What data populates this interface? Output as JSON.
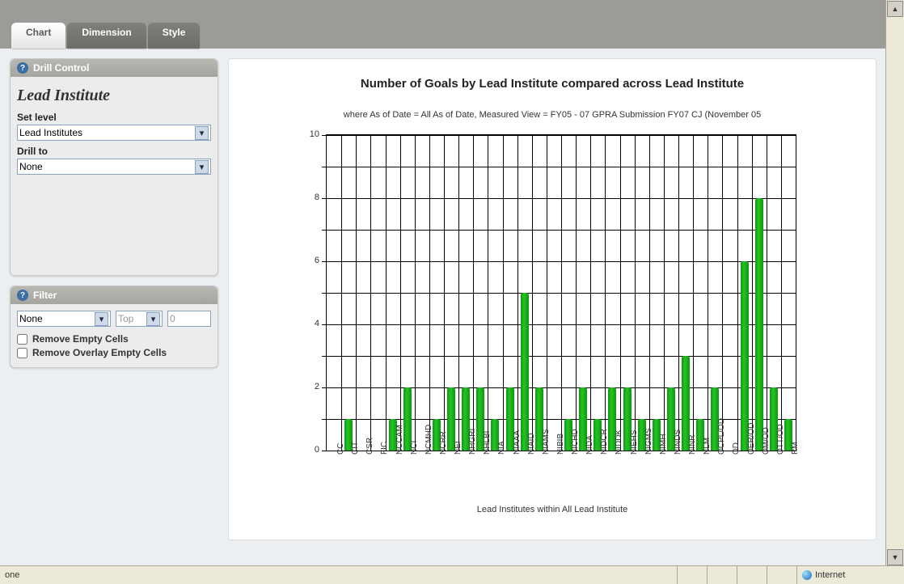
{
  "tabs": {
    "chart": "Chart",
    "dimension": "Dimension",
    "style": "Style"
  },
  "drill": {
    "panel_title": "Drill Control",
    "heading": "Lead Institute",
    "set_level_label": "Set level",
    "set_level_value": "Lead Institutes",
    "drill_to_label": "Drill to",
    "drill_to_value": "None"
  },
  "filter": {
    "panel_title": "Filter",
    "scope_value": "None",
    "dir_value": "Top",
    "count_value": "0",
    "remove_empty_label": "Remove Empty Cells",
    "remove_overlay_label": "Remove Overlay Empty Cells"
  },
  "chart_data": {
    "type": "bar",
    "title": "Number of Goals by Lead Institute compared across Lead Institute",
    "subtitle": "where As of Date = All As of Date,  Measured View = FY05 - 07 GPRA Submission FY07 CJ (November 05",
    "xlabel": "Lead Institutes within All Lead Institute",
    "ylabel": "",
    "ylim": [
      0,
      10
    ],
    "yticks_major": [
      0,
      2,
      4,
      6,
      8,
      10
    ],
    "categories": [
      "CC",
      "CIT",
      "CSR",
      "FIC",
      "NCCAM",
      "NCI",
      "NCMHD",
      "NCRR",
      "NEI",
      "NHGRI",
      "NHLBI",
      "NIA",
      "NIAAA",
      "NIAID",
      "NIAMS",
      "NIBIB",
      "NICHD",
      "NIDA",
      "NIDCR",
      "NIDDK",
      "NIEHS",
      "NIGMS",
      "NIMH",
      "NINDS",
      "NINR",
      "NLM",
      "OCPL/OD",
      "OD",
      "OER/OD",
      "OM/OD",
      "OTT/OD",
      "RM"
    ],
    "values": [
      0,
      1,
      0,
      0,
      1,
      2,
      0,
      1,
      2,
      2,
      2,
      1,
      2,
      5,
      2,
      0,
      1,
      2,
      1,
      2,
      2,
      1,
      1,
      2,
      3,
      1,
      2,
      0,
      6,
      8,
      2,
      1
    ]
  },
  "status": {
    "left": "one",
    "zone": "Internet"
  }
}
